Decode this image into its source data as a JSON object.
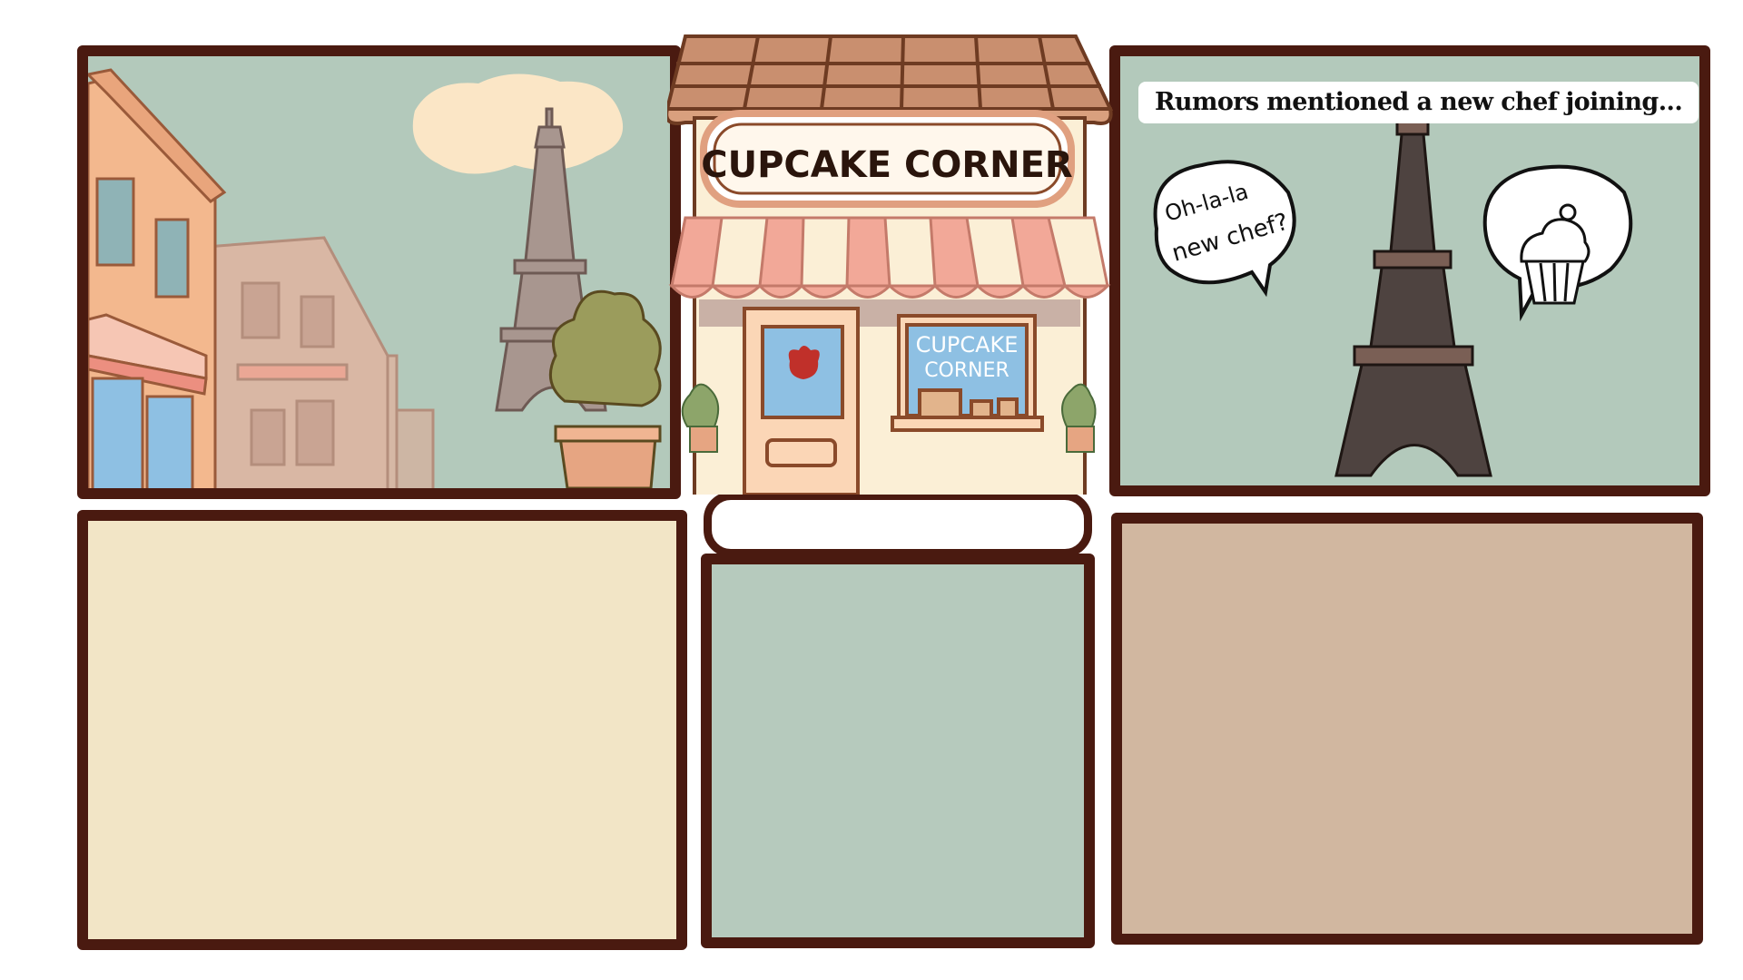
{
  "shop": {
    "sign": "CUPCAKE CORNER",
    "window_line1": "CUPCAKE",
    "window_line2": "CORNER"
  },
  "panel3": {
    "caption": "Rumors mentioned a new chef joining...",
    "bubble_line1": "Oh-la-la",
    "bubble_line2": "new chef?",
    "bubble_right_icon": "cupcake-icon"
  },
  "colors": {
    "outline": "#4a1a10",
    "sky": "#b3c9bb",
    "panel4": "#f2e5c6",
    "panel5": "#b6cabd",
    "panel6": "#d1b7a0",
    "awning_pink": "#f2a898",
    "awning_cream": "#fbefd6"
  }
}
